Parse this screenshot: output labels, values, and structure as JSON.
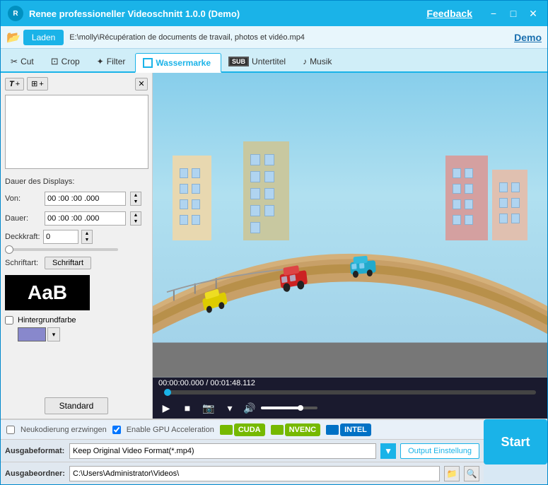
{
  "titlebar": {
    "title": "Renee professioneller Videoschnitt 1.0.0 (Demo)",
    "feedback": "Feedback",
    "minimize": "−",
    "maximize": "□",
    "close": "✕",
    "logo_text": "R"
  },
  "toolbar": {
    "load_label": "Laden",
    "file_path": "E:\\molly\\Récupération de documents de travail, photos et vidéo.mp4",
    "demo_label": "Demo"
  },
  "tabs": [
    {
      "id": "cut",
      "label": "Cut",
      "icon": "✂"
    },
    {
      "id": "crop",
      "label": "Crop",
      "icon": "⊞"
    },
    {
      "id": "filter",
      "label": "Filter",
      "icon": "✦"
    },
    {
      "id": "wassermarke",
      "label": "Wassermarke",
      "icon": "◻",
      "active": true
    },
    {
      "id": "untertitel",
      "label": "Untertitel",
      "icon": "SUB"
    },
    {
      "id": "musik",
      "label": "Musik",
      "icon": "♪"
    }
  ],
  "left_panel": {
    "text_btn": "T+",
    "image_btn": "⊞+",
    "close_btn": "✕",
    "display_section": "Dauer des Displays:",
    "von_label": "Von:",
    "von_value": "00 :00 :00 .000",
    "dauer_label": "Dauer:",
    "dauer_value": "00 :00 :00 .000",
    "deckkraft_label": "Deckkraft:",
    "deckkraft_value": "0",
    "schriftart_section": "Schriftart:",
    "schriftart_btn": "Schriftart",
    "font_preview": "AaB",
    "bg_color_label": "Hintergrundfarbe",
    "standard_btn": "Standard"
  },
  "video": {
    "time_current": "00:00:00.000",
    "time_total": "00:01:48.112",
    "time_separator": " / ",
    "play_btn": "▶",
    "stop_btn": "■",
    "camera_btn": "📷",
    "dropdown_btn": "▾",
    "volume_icon": "🔊"
  },
  "bottom": {
    "neukodierung_label": "Neukodierung erzwingen",
    "gpu_label": "Enable GPU Acceleration",
    "cuda_label": "CUDA",
    "nvenc_label": "NVENC",
    "intel_label": "INTEL",
    "ausgabeformat_label": "Ausgabeformat:",
    "format_value": "Keep Original Video Format(*.mp4)",
    "output_settings_btn": "Output Einstellung",
    "ausgabeordner_label": "Ausgabeordner:",
    "folder_path": "C:\\Users\\Administrator\\Videos\\",
    "start_btn": "Start"
  }
}
